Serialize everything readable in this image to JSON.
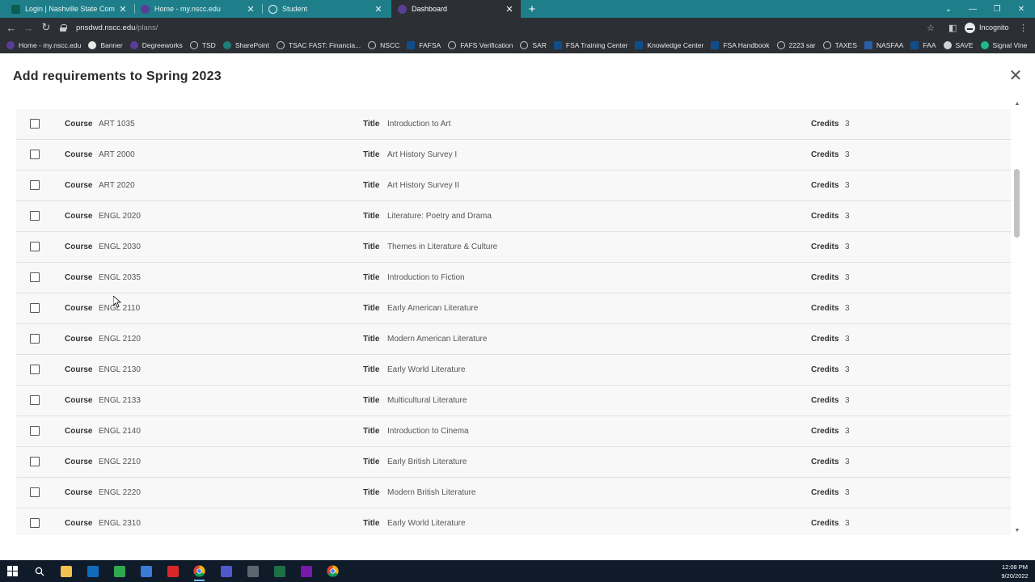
{
  "browser": {
    "tabs": [
      {
        "title": "Login | Nashville State Communi",
        "icon": "nscc-icon",
        "active": false
      },
      {
        "title": "Home - my.nscc.edu",
        "icon": "purple-app-icon",
        "active": false
      },
      {
        "title": "Student",
        "icon": "globe-icon",
        "active": false
      },
      {
        "title": "Dashboard",
        "icon": "purple-app-icon",
        "active": true
      }
    ],
    "url_host": "pnsdwd.nscc.edu",
    "url_path": "/plans/",
    "profile_label": "Incognito",
    "bookmarks": [
      {
        "label": "Home - my.nscc.edu",
        "icon": "purple-app-icon"
      },
      {
        "label": "Banner",
        "icon": "banner-icon"
      },
      {
        "label": "Degreeworks",
        "icon": "purple-app-icon"
      },
      {
        "label": "TSD",
        "icon": "globe-icon"
      },
      {
        "label": "SharePoint",
        "icon": "sharepoint-icon"
      },
      {
        "label": "TSAC FAST: Financia...",
        "icon": "globe-icon"
      },
      {
        "label": "NSCC",
        "icon": "globe-icon"
      },
      {
        "label": "FAFSA",
        "icon": "fsa-icon"
      },
      {
        "label": "FAFS Verification",
        "icon": "globe-icon"
      },
      {
        "label": "SAR",
        "icon": "globe-icon"
      },
      {
        "label": "FSA Training Center",
        "icon": "fsa-icon"
      },
      {
        "label": "Knowledge Center",
        "icon": "fsa-icon"
      },
      {
        "label": "FSA Handbook",
        "icon": "fsa-icon"
      },
      {
        "label": "2223 sar",
        "icon": "globe-icon"
      },
      {
        "label": "TAXES",
        "icon": "globe-icon"
      },
      {
        "label": "NASFAA",
        "icon": "nasfaa-icon"
      },
      {
        "label": "FAA",
        "icon": "fsa-icon"
      },
      {
        "label": "SAVE",
        "icon": "save-icon"
      },
      {
        "label": "Signal Vine",
        "icon": "signal-vine-icon"
      }
    ]
  },
  "modal": {
    "title": "Add requirements to Spring 2023",
    "course_label": "Course",
    "title_label": "Title",
    "credits_label": "Credits",
    "rows": [
      {
        "course": "ART 1035",
        "title": "Introduction to Art",
        "credits": "3"
      },
      {
        "course": "ART 2000",
        "title": "Art History Survey I",
        "credits": "3"
      },
      {
        "course": "ART 2020",
        "title": "Art History Survey II",
        "credits": "3"
      },
      {
        "course": "ENGL 2020",
        "title": "Literature: Poetry and Drama",
        "credits": "3"
      },
      {
        "course": "ENGL 2030",
        "title": "Themes in Literature & Culture",
        "credits": "3"
      },
      {
        "course": "ENGL 2035",
        "title": "Introduction to Fiction",
        "credits": "3"
      },
      {
        "course": "ENGL 2110",
        "title": "Early American Literature",
        "credits": "3"
      },
      {
        "course": "ENGL 2120",
        "title": "Modern American Literature",
        "credits": "3"
      },
      {
        "course": "ENGL 2130",
        "title": "Early World Literature",
        "credits": "3"
      },
      {
        "course": "ENGL 2133",
        "title": "Multicultural Literature",
        "credits": "3"
      },
      {
        "course": "ENGL 2140",
        "title": "Introduction to Cinema",
        "credits": "3"
      },
      {
        "course": "ENGL 2210",
        "title": "Early British Literature",
        "credits": "3"
      },
      {
        "course": "ENGL 2220",
        "title": "Modern British Literature",
        "credits": "3"
      },
      {
        "course": "ENGL 2310",
        "title": "Early World Literature",
        "credits": "3"
      }
    ]
  },
  "taskbar": {
    "apps": [
      "windows-start-icon",
      "search-icon",
      "file-explorer-icon",
      "outlook-icon",
      "green-app-icon",
      "snip-tool-icon",
      "acrobat-icon",
      "chrome-icon",
      "teams-icon",
      "calculator-icon",
      "excel-icon",
      "onenote-icon",
      "chrome-icon"
    ],
    "time": "12:08 PM",
    "date": "9/20/2022"
  },
  "colors": {
    "tabstrip": "#1e7f8b",
    "toolbar": "#2c3035",
    "row_background": "#f8f8f8",
    "taskbar": "#101b2a"
  }
}
